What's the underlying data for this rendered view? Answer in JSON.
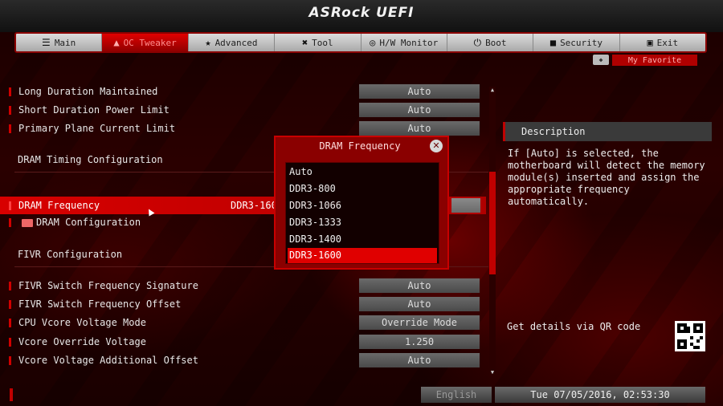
{
  "app": {
    "logo": "ASRock UEFI"
  },
  "tabs": [
    {
      "label": "Main",
      "icon": "☰"
    },
    {
      "label": "OC Tweaker",
      "icon": "▲"
    },
    {
      "label": "Advanced",
      "icon": "★"
    },
    {
      "label": "Tool",
      "icon": "✖"
    },
    {
      "label": "H/W Monitor",
      "icon": "◎"
    },
    {
      "label": "Boot",
      "icon": "⏻"
    },
    {
      "label": "Security",
      "icon": "■"
    },
    {
      "label": "Exit",
      "icon": "▣"
    }
  ],
  "favorite": {
    "label": "My Favorite",
    "dot": "◆"
  },
  "settings": {
    "long_duration": {
      "label": "Long Duration Maintained",
      "value": "Auto"
    },
    "short_duration": {
      "label": "Short Duration Power Limit",
      "value": "Auto"
    },
    "primary_plane": {
      "label": "Primary Plane Current Limit",
      "value": "Auto"
    },
    "dram_timing_section": "DRAM Timing Configuration",
    "dram_frequency": {
      "label": "DRAM Frequency",
      "value": "DDR3-1600"
    },
    "dram_configuration": {
      "label": "DRAM Configuration"
    },
    "fivr_section": "FIVR Configuration",
    "fivr_switch_sig": {
      "label": "FIVR Switch Frequency Signature",
      "value": "Auto"
    },
    "fivr_switch_off": {
      "label": "FIVR Switch Frequency Offset",
      "value": "Auto"
    },
    "vcore_mode": {
      "label": "CPU Vcore Voltage Mode",
      "value": "Override Mode"
    },
    "vcore_override": {
      "label": "Vcore Override Voltage",
      "value": "1.250"
    },
    "vcore_additional": {
      "label": "Vcore Voltage Additional Offset",
      "value": "Auto"
    }
  },
  "popup": {
    "title": "DRAM Frequency",
    "close": "✕",
    "options": [
      "Auto",
      "DDR3-800",
      "DDR3-1066",
      "DDR3-1333",
      "DDR3-1400",
      "DDR3-1600"
    ],
    "selected_index": 5
  },
  "description": {
    "title": "Description",
    "body": "If [Auto] is selected, the motherboard will detect the memory module(s) inserted and assign the appropriate frequency automatically.",
    "qr_label": "Get details via QR code"
  },
  "footer": {
    "language": "English",
    "datetime": "Tue 07/05/2016, 02:53:30"
  },
  "colors": {
    "accent": "#d00000",
    "background": "#1a0000"
  }
}
